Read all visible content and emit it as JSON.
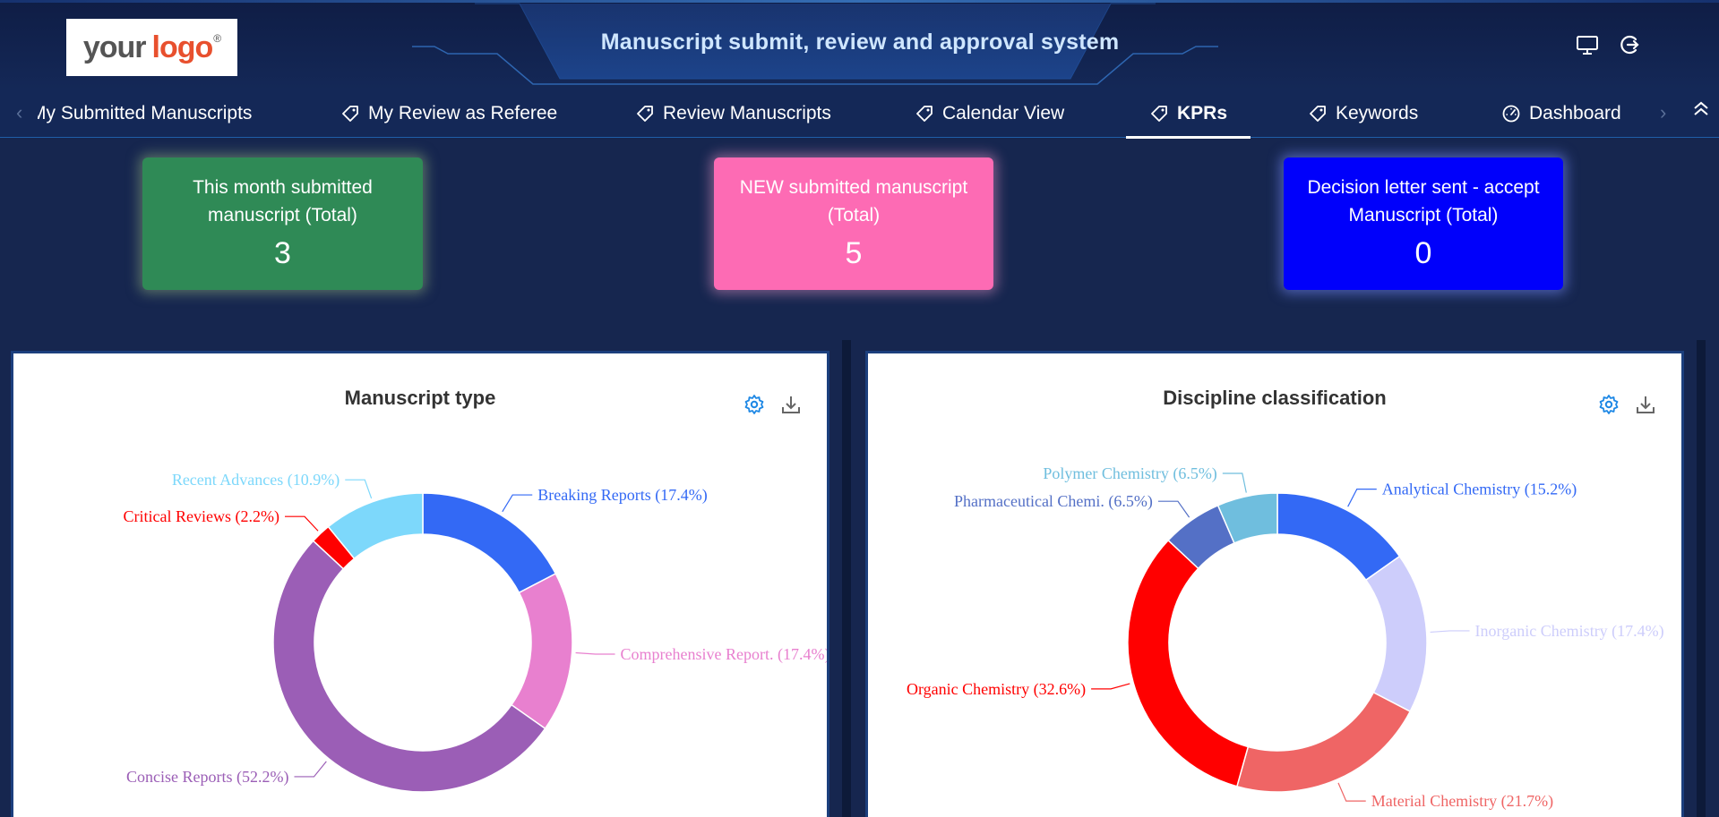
{
  "header": {
    "logo_text_1": "your",
    "logo_text_2": "logo",
    "logo_mark": "®",
    "title": "Manuscript submit, review and approval system",
    "icons": [
      "monitor-icon",
      "logout-icon"
    ]
  },
  "nav": {
    "items": [
      {
        "label": "My Submitted Manuscripts",
        "icon": "tag-icon"
      },
      {
        "label": "My Review as Referee",
        "icon": "tag-icon"
      },
      {
        "label": "Review Manuscripts",
        "icon": "tag-icon"
      },
      {
        "label": "Calendar View",
        "icon": "tag-icon"
      },
      {
        "label": "KPRs",
        "icon": "tag-icon",
        "active": true
      },
      {
        "label": "Keywords",
        "icon": "tag-icon"
      },
      {
        "label": "Dashboard",
        "icon": "dashboard-icon"
      }
    ]
  },
  "kpis": [
    {
      "label": "This month submitted manuscript (Total)",
      "value": "3",
      "color": "#2f8a56"
    },
    {
      "label": "NEW submitted manuscript (Total)",
      "value": "5",
      "color": "#fd6bb4"
    },
    {
      "label": "Decision letter sent - accept Manuscript (Total)",
      "value": "0",
      "color": "#0000fb"
    }
  ],
  "chart_data": [
    {
      "type": "pie",
      "title": "Manuscript type",
      "series": [
        {
          "name": "Breaking Reports",
          "value": 17.4,
          "label": "Breaking Reports (17.4%)",
          "color": "#3369f5"
        },
        {
          "name": "Comprehensive Report.",
          "value": 17.4,
          "label": "Comprehensive Report. (17.4%)",
          "color": "#e880cf"
        },
        {
          "name": "Concise Reports",
          "value": 52.2,
          "label": "Concise Reports (52.2%)",
          "color": "#9b5eb6"
        },
        {
          "name": "Critical Reviews",
          "value": 2.2,
          "label": "Critical Reviews (2.2%)",
          "color": "#ff0000"
        },
        {
          "name": "Recent Advances",
          "value": 10.9,
          "label": "Recent Advances (10.9%)",
          "color": "#7dd8fb"
        }
      ]
    },
    {
      "type": "pie",
      "title": "Discipline classification",
      "series": [
        {
          "name": "Analytical Chemistry",
          "value": 15.2,
          "label": "Analytical Chemistry (15.2%)",
          "color": "#3369f5"
        },
        {
          "name": "Inorganic Chemistry",
          "value": 17.4,
          "label": "Inorganic Chemistry (17.4%)",
          "color": "#cdcdfb"
        },
        {
          "name": "Material Chemistry",
          "value": 21.7,
          "label": "Material Chemistry (21.7%)",
          "color": "#ef6565"
        },
        {
          "name": "Organic Chemistry",
          "value": 32.6,
          "label": "Organic Chemistry (32.6%)",
          "color": "#ff0000"
        },
        {
          "name": "Pharmaceutical Chemi.",
          "value": 6.5,
          "label": "Pharmaceutical Chemi. (6.5%)",
          "color": "#5470c6"
        },
        {
          "name": "Polymer Chemistry",
          "value": 6.5,
          "label": "Polymer Chemistry (6.5%)",
          "color": "#6fbede"
        }
      ]
    }
  ]
}
